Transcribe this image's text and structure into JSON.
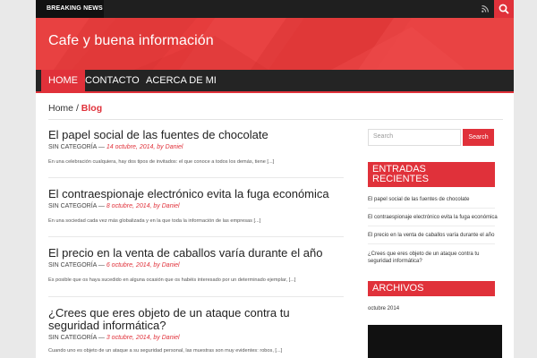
{
  "topbar": {
    "breaking_label": "BREAKING NEWS",
    "icons": [
      "rss-icon",
      "search-icon"
    ]
  },
  "header": {
    "site_title": "Cafe y buena información"
  },
  "nav": {
    "items": [
      "HOME",
      "CONTACTO",
      "ACERCA DE MI"
    ],
    "active": "HOME"
  },
  "breadcrumb": {
    "home": "Home",
    "separator": "/",
    "current": "Blog"
  },
  "posts": [
    {
      "title": "El papel social de las fuentes de chocolate",
      "category": "SIN CATEGORÍA",
      "dash": "—",
      "date": "14 octubre, 2014",
      "by": ", by",
      "author": "Daniel",
      "excerpt": "En una celebración cualquiera, hay dos tipos de invitados: el que conoce a todos los demás, tiene [...]"
    },
    {
      "title": "El contraespionaje electrónico evita la fuga económica",
      "category": "SIN CATEGORÍA",
      "dash": "—",
      "date": "8 octubre, 2014",
      "by": ", by",
      "author": "Daniel",
      "excerpt": "En una sociedad cada vez más globalizada y en la que toda la información de las empresas [...]"
    },
    {
      "title": "El precio en la venta de caballos varía durante el año",
      "category": "SIN CATEGORÍA",
      "dash": "—",
      "date": "6 octubre, 2014",
      "by": ", by",
      "author": "Daniel",
      "excerpt": "Es posible que os haya sucedido en alguna ocasión que os habéis interesado por un determinado ejemplar, [...]"
    },
    {
      "title_line1": "¿Crees que eres objeto de un ataque contra tu",
      "title_line2": "seguridad informática?",
      "category": "SIN CATEGORÍA",
      "dash": "—",
      "date": "3 octubre, 2014",
      "by": ", by",
      "author": "Daniel",
      "excerpt": "Cuando uno es objeto de un ataque a su seguridad personal, las muestras son muy evidentes: robos, [...]"
    }
  ],
  "sidebar": {
    "search_placeholder": "Search",
    "search_button": "Search",
    "recent_title_line1": "ENTRADAS",
    "recent_title_line2": "RECIENTES",
    "recent": [
      "El papel social de las fuentes de chocolate",
      "El contraespionaje electrónico evita la fuga económica",
      "El precio en la venta de caballos varía durante el año",
      "¿Crees que eres objeto de un ataque contra tu",
      "seguridad informática?"
    ],
    "archives_title": "ARCHIVOS",
    "archives": [
      "octubre 2014"
    ]
  },
  "colors": {
    "accent": "#e0313a",
    "header": "#e63c3c",
    "nav": "#242424",
    "topbar": "#1f1f1f"
  }
}
